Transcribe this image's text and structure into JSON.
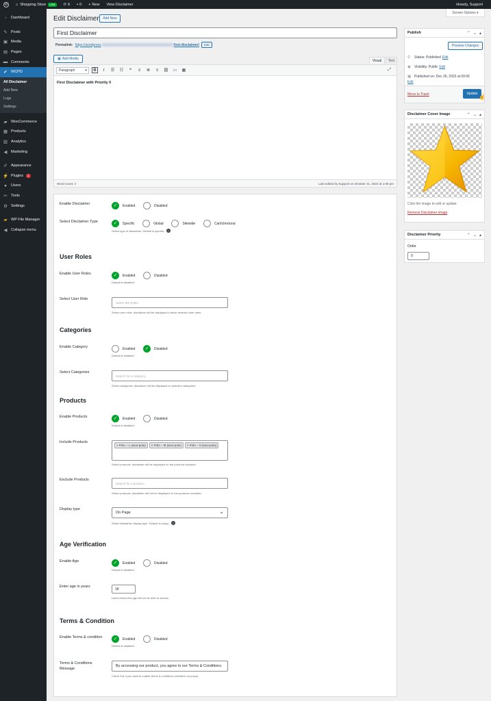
{
  "adminbar": {
    "site_name": "Shopping Store",
    "live_label": "Live",
    "updates_count": "6",
    "comments_count": "0",
    "new_label": "New",
    "view_label": "View Disclaimer",
    "howdy": "Howdy, Support"
  },
  "sidebar": {
    "dashboard": "Dashboard",
    "posts": "Posts",
    "media": "Media",
    "pages": "Pages",
    "comments": "Comments",
    "wcpd": "WCPD",
    "submenu": [
      "All Disclaimer",
      "Add New",
      "Logs",
      "Settings"
    ],
    "woocommerce": "WooCommerce",
    "products": "Products",
    "analytics": "Analytics",
    "marketing": "Marketing",
    "appearance": "Appearance",
    "plugins": "Plugins",
    "plugins_badge": "1",
    "users": "Users",
    "tools": "Tools",
    "settings": "Settings",
    "file_manager": "WP File Manager",
    "collapse": "Collapse menu"
  },
  "header": {
    "screen_options": "Screen Options ▾",
    "title": "Edit Disclaimer",
    "add_new": "Add New"
  },
  "post": {
    "title": "First Disclaimer",
    "permalink_label": "Permalink:",
    "permalink_start": "https://wordpress",
    "permalink_end": "first-disclaimer/",
    "permalink_edit": "Edit"
  },
  "editor": {
    "add_media": "Add Media",
    "tab_visual": "Visual",
    "tab_text": "Text",
    "format": "Paragraph",
    "content": "First Disclaimer with Priority 0",
    "word_count": "Word count: 4",
    "last_edited": "Last edited by Support on October 21, 2024 at 1:08 pm"
  },
  "settings": {
    "enabled": "Enabled",
    "disabled": "Disabled",
    "enable_disclaimer_label": "Enable Disclaimer",
    "type_label": "Select Disclaimer Type",
    "type_options": [
      "Specific",
      "Global",
      "Sitewide",
      "Cart/checkout"
    ],
    "type_help": "Select type of disclaimer. Default is specific.",
    "user_roles_title": "User Roles",
    "enable_user_roles_label": "Enable User Roles",
    "default_disabled": "Default is disabled.",
    "select_user_role_label": "Select User Role",
    "select_roles_placeholder": "Select the Roles",
    "roles_help": "Select user roles, disclaimer will be displayed to these selected user roles.",
    "categories_title": "Categories",
    "enable_category_label": "Enable Category",
    "select_categories_label": "Select Categories",
    "category_placeholder": "Search for a category...",
    "categories_help": "Select categories, disclaimer will be displayed on selected categories.",
    "products_title": "Products",
    "enable_products_label": "Enable Products",
    "include_products_label": "Include Products",
    "included_products": [
      "× Polo – L (woo-polo)",
      "× Polo – M (woo-polo)",
      "× Polo – S (woo-polo)"
    ],
    "include_help": "Select products, disclaimer will be displayed on the products included.",
    "exclude_products_label": "Exclude Products",
    "product_placeholder": "Search for a product...",
    "exclude_help": "Select products, disclaimer will not be displayed on the products excluded.",
    "display_type_label": "Display type",
    "display_type_value": "On Page",
    "display_help": "Select disclaimer display type. Default is popup.",
    "age_title": "Age Verification",
    "enable_age_label": "Enable Age",
    "age_years_label": "Enter age in years",
    "age_value": "18",
    "age_help": "Users below this age will not be able to access.",
    "terms_title": "Terms & Condition",
    "enable_terms_label": "Enable Terms & condition",
    "terms_message_label": "Terms & Conditions Message",
    "terms_message_value": "By accessing our product, you agree to our Terms & Conditions.",
    "terms_help": "Check this if you want to enable terms & conditions checkbox on popup."
  },
  "publish": {
    "title": "Publish",
    "preview": "Preview Changes",
    "status": "Status: Published",
    "visibility": "Visibility: Public",
    "published_on": "Published on: Dec 26, 2023 at 09:06",
    "edit": "Edit",
    "trash": "Move to Trash",
    "update": "Update"
  },
  "cover": {
    "title": "Disclaimer Cover Image",
    "help": "Click the image to edit or update",
    "remove": "Remove Disclaimer image"
  },
  "priority": {
    "title": "Disclaimer Priority",
    "order_label": "Order",
    "order_value": "0"
  }
}
